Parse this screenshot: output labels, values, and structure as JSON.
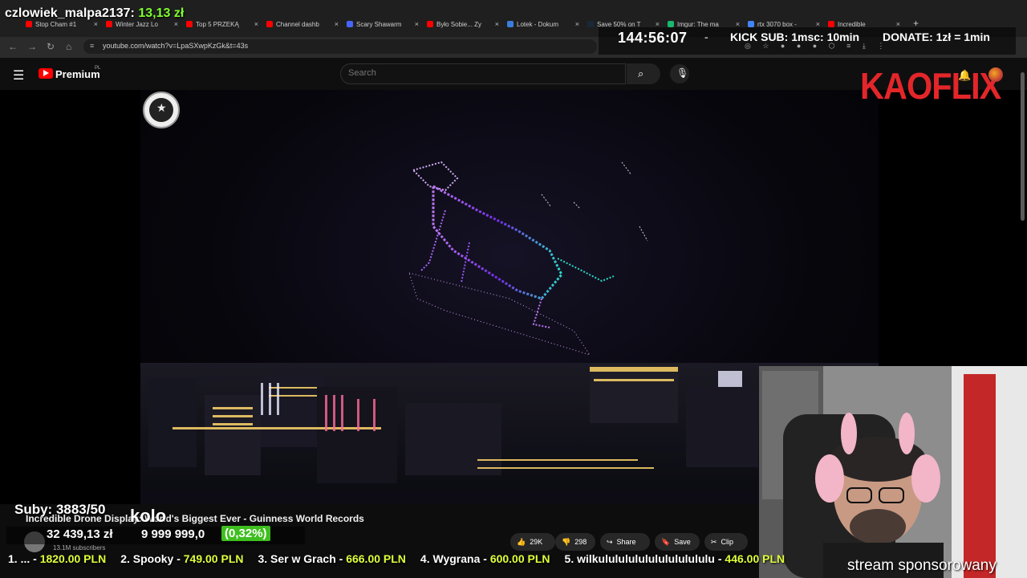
{
  "browser": {
    "tabs": [
      {
        "label": "Stop Cham #1",
        "color": "#ff0000"
      },
      {
        "label": "Winter Jazz Lo",
        "color": "#ff0000"
      },
      {
        "label": "Top 5 PRZEKĄ",
        "color": "#ff0000"
      },
      {
        "label": "Channel dashb",
        "color": "#ff0000"
      },
      {
        "label": "Scary Shawarm",
        "color": "#4466ff"
      },
      {
        "label": "Było Sobie... Zy",
        "color": "#ff0000"
      },
      {
        "label": "Lotek - Dokum",
        "color": "#3b7dde"
      },
      {
        "label": "Save 50% on T",
        "color": "#1b2838"
      },
      {
        "label": "Imgur: The ma",
        "color": "#1bb76e"
      },
      {
        "label": "rtx 3070 box -",
        "color": "#4285f4"
      },
      {
        "label": "Incredible",
        "color": "#ff0000"
      }
    ],
    "new_tab_label": "+",
    "url": "youtube.com/watch?v=LpaSXwpKzGk&t=43s"
  },
  "stream": {
    "viewer_name": "czlowiek_malpa2137:",
    "viewer_amount": "13,13 zł",
    "timer": "144:56:07",
    "dash": "-",
    "kick_sub": "KICK SUB: 1msc: 10min",
    "donate": "DONATE: 1zł = 1min",
    "brand": "KAOFLIX",
    "suby": "Suby: 3883/50",
    "kolo": "kolo",
    "money": "32 439,13 zł",
    "goal": "9 999 999,0",
    "percent": "(0,32%)",
    "ticker": [
      {
        "rank": "1. ... -",
        "amount": "1820.00 PLN"
      },
      {
        "rank": "2. Spooky -",
        "amount": "749.00 PLN"
      },
      {
        "rank": "3. Ser w Grach -",
        "amount": "666.00 PLN"
      },
      {
        "rank": "4. Wygrana -",
        "amount": "600.00 PLN"
      },
      {
        "rank": "5. wilkulululululululululululu -",
        "amount": "446.00 PLN"
      }
    ],
    "sponsor_text": "stream sponsorowany"
  },
  "youtube": {
    "premium_label": "Premium",
    "region": "PL",
    "search_placeholder": "Search",
    "video_title": "Incredible Drone Display: World's Biggest Ever - Guinness World Records",
    "subscribers": "13.1M subscribers",
    "likes": "29K",
    "dislikes": "298",
    "share_label": "Share",
    "save_label": "Save",
    "clip_label": "Clip"
  },
  "icons": {
    "menu": "menu-icon",
    "search": "search-icon",
    "mic": "mic-icon",
    "bell": "bell-icon"
  }
}
